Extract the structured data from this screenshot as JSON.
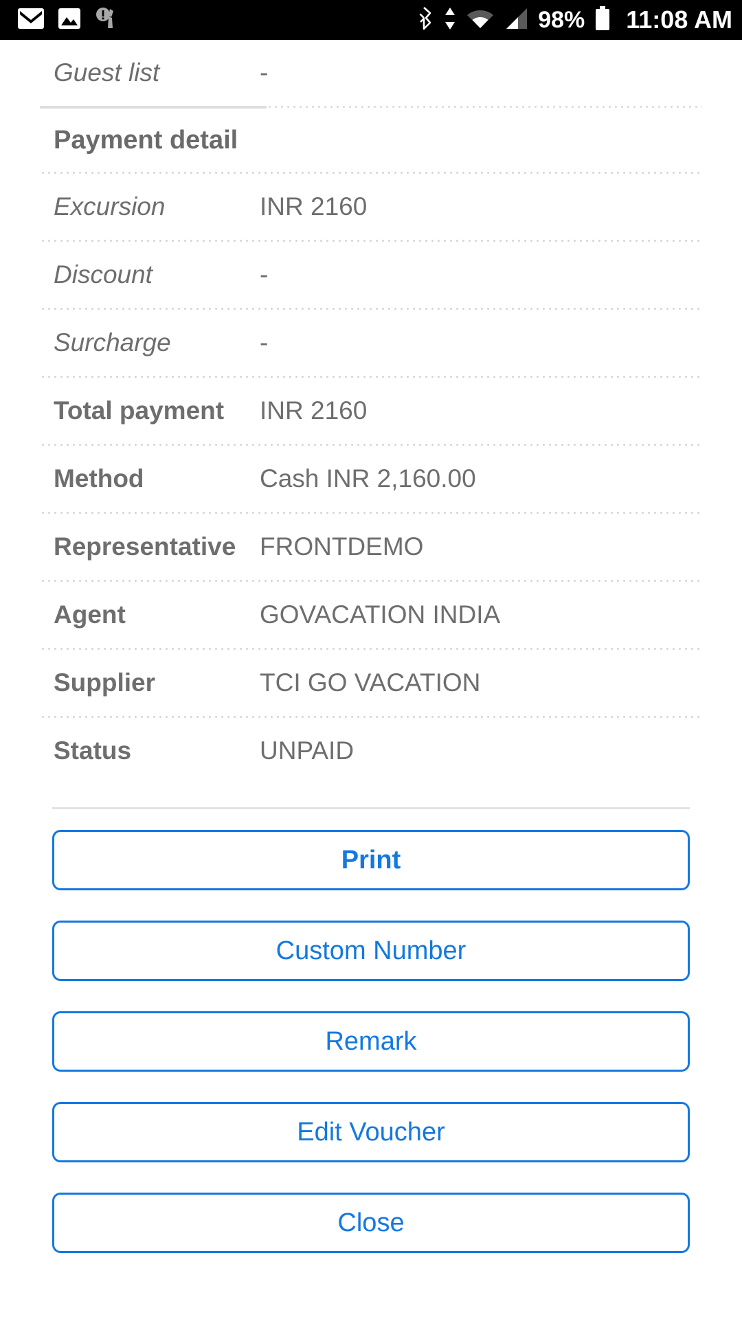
{
  "statusbar": {
    "time": "11:08 AM",
    "battery_percent": "98%",
    "left_icons": [
      "gmail-icon",
      "photos-icon",
      "cleaner-alert-icon"
    ],
    "right_icons": [
      "bluetooth-icon",
      "data-transfer-icon",
      "wifi-icon",
      "cellular-signal-icon",
      "battery-icon"
    ],
    "background_color": "#000000"
  },
  "theme": {
    "accent_blue": "#1478e0",
    "text_gray": "#6e6e6e",
    "divider_gray": "#d6d6d6",
    "page_background": "#ffffff"
  },
  "details": {
    "top_rows": [
      {
        "label": "Guest list",
        "value": "-",
        "style": "italic"
      }
    ],
    "section_title": "Payment detail",
    "payment_rows": [
      {
        "label": "Excursion",
        "value": "INR 2160",
        "style": "italic"
      },
      {
        "label": "Discount",
        "value": "-",
        "style": "italic"
      },
      {
        "label": "Surcharge",
        "value": "-",
        "style": "italic"
      },
      {
        "label": "Total payment",
        "value": "INR 2160",
        "style": "bold"
      },
      {
        "label": "Method",
        "value": "Cash INR 2,160.00",
        "style": "bold"
      },
      {
        "label": "Representative",
        "value": "FRONTDEMO",
        "style": "bold"
      },
      {
        "label": "Agent",
        "value": "GOVACATION INDIA",
        "style": "bold"
      },
      {
        "label": "Supplier",
        "value": "TCI GO VACATION",
        "style": "bold"
      },
      {
        "label": "Status",
        "value": "UNPAID",
        "style": "bold"
      }
    ]
  },
  "actions": [
    {
      "label": "Print",
      "emphasis": "primary"
    },
    {
      "label": "Custom Number",
      "emphasis": "normal"
    },
    {
      "label": "Remark",
      "emphasis": "normal"
    },
    {
      "label": "Edit Voucher",
      "emphasis": "normal"
    },
    {
      "label": "Close",
      "emphasis": "normal"
    }
  ]
}
